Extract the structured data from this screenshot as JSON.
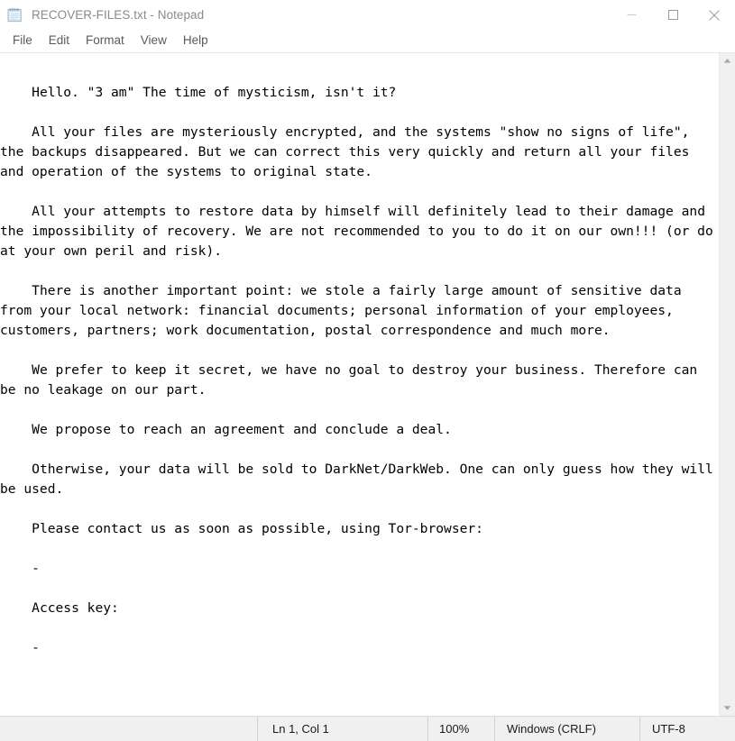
{
  "window": {
    "title": "RECOVER-FILES.txt - Notepad",
    "icon": "notepad-icon",
    "controls": {
      "minimize": "minimize-icon",
      "maximize": "maximize-icon",
      "close": "close-icon"
    }
  },
  "menu": {
    "items": [
      {
        "label": "File"
      },
      {
        "label": "Edit"
      },
      {
        "label": "Format"
      },
      {
        "label": "View"
      },
      {
        "label": "Help"
      }
    ]
  },
  "document": {
    "text": "\n    Hello. \"3 am\" The time of mysticism, isn't it?\n\n    All your files are mysteriously encrypted, and the systems \"show no signs of life\", the backups disappeared. But we can correct this very quickly and return all your files and operation of the systems to original state.\n\n    All your attempts to restore data by himself will definitely lead to their damage and the impossibility of recovery. We are not recommended to you to do it on our own!!! (or do at your own peril and risk).\n\n    There is another important point: we stole a fairly large amount of sensitive data from your local network: financial documents; personal information of your employees, customers, partners; work documentation, postal correspondence and much more.\n\n    We prefer to keep it secret, we have no goal to destroy your business. Therefore can be no leakage on our part.\n\n    We propose to reach an agreement and conclude a deal.\n\n    Otherwise, your data will be sold to DarkNet/DarkWeb. One can only guess how they will be used.\n\n    Please contact us as soon as possible, using Tor-browser:\n\n    -\n\n    Access key:\n\n    -\n"
  },
  "scrollbar": {
    "up_arrow": "scroll-up-icon",
    "down_arrow": "scroll-down-icon"
  },
  "statusbar": {
    "cursor_position": "Ln 1, Col 1",
    "zoom": "100%",
    "line_ending": "Windows (CRLF)",
    "encoding": "UTF-8"
  },
  "colors": {
    "titlebar_bg": "#ffffff",
    "title_text": "#8a8a8a",
    "menu_text": "#5a5a5a",
    "text_bg": "#ffffff",
    "text_fg": "#000000",
    "statusbar_bg": "#f0f0f0",
    "scrollbar_bg": "#f0f0f0",
    "scrollbar_thumb": "#cdcdcd",
    "divider": "#d2d2d2"
  }
}
